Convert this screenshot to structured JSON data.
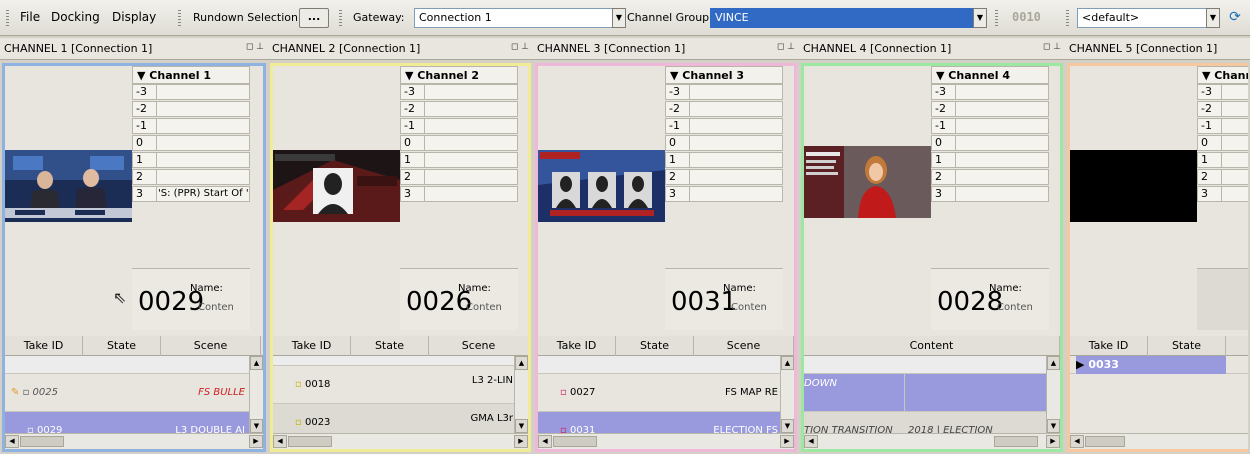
{
  "menu": {
    "file": "File",
    "docking": "Docking",
    "display": "Display"
  },
  "toolbar": {
    "rundown_label": "Rundown Selection:",
    "rundown_button": "...",
    "gateway_label": "Gateway:",
    "gateway_value": "Connection 1",
    "channel_group_label": "Channel Group:",
    "channel_group_value": "VINCE",
    "counter": "0010",
    "profile_value": "<default>"
  },
  "colors": {
    "ch1": "#8fb3e0",
    "ch2": "#f0ec96",
    "ch3": "#f0b8d8",
    "ch4": "#9ce8a0",
    "ch5": "#f5c8a0",
    "selected": "#9999dd"
  },
  "levels_labels": [
    "-3",
    "-2",
    "-1",
    "0",
    "1",
    "2",
    "3"
  ],
  "grid_headers": {
    "take_id": "Take ID",
    "state": "State",
    "scene": "Scene",
    "content": "Content"
  },
  "take_labels": {
    "name": "Name:",
    "content": "Conten"
  },
  "channels": [
    {
      "title": "CHANNEL 1 [Connection 1]",
      "header": "Channel 1",
      "level3_value": "'S: (PPR) Start Of '",
      "take_id": "0029",
      "thumb": "news-anchors-desk",
      "rows": [
        {
          "take_id": "0025",
          "state": "",
          "scene": "FS BULLE",
          "icon": "pencil-icon"
        },
        {
          "take_id": "0029",
          "state": "",
          "scene": "L3 DOUBLE AI",
          "icon": "take-box-icon"
        }
      ]
    },
    {
      "title": "CHANNEL 2 [Connection 1]",
      "header": "Channel 2",
      "level3_value": "",
      "take_id": "0026",
      "thumb": "lower-third-headshot",
      "rows": [
        {
          "take_id": "0018",
          "state": "",
          "scene": "L3 2-LIN",
          "icon": "take-box-icon"
        },
        {
          "take_id": "0023",
          "state": "",
          "scene": "GMA L3r",
          "icon": "take-box-icon"
        }
      ]
    },
    {
      "title": "CHANNEL 3 [Connection 1]",
      "header": "Channel 3",
      "level3_value": "",
      "take_id": "0031",
      "thumb": "election-three-headshots",
      "rows": [
        {
          "take_id": "0027",
          "state": "",
          "scene": "FS MAP RE",
          "icon": "take-box-icon"
        },
        {
          "take_id": "0031",
          "state": "",
          "scene": "ELECTION FS",
          "icon": "take-box-icon"
        }
      ]
    },
    {
      "title": "CHANNEL 4 [Connection 1]",
      "header": "Channel 4",
      "level3_value": "",
      "take_id": "0028",
      "thumb": "presenter-red-jacket",
      "rows": [
        {
          "content": "DOWN",
          "content2": ""
        },
        {
          "content": "TION TRANSITION",
          "content2": "2018 | ELECTION"
        }
      ]
    },
    {
      "title": "CHANNEL 5 [Connection 1]",
      "header": "Chann",
      "level3_value": "",
      "take_id": "0033",
      "thumb": "black-frame",
      "rows": [
        {
          "take_id": "0033",
          "state": ""
        }
      ]
    }
  ]
}
